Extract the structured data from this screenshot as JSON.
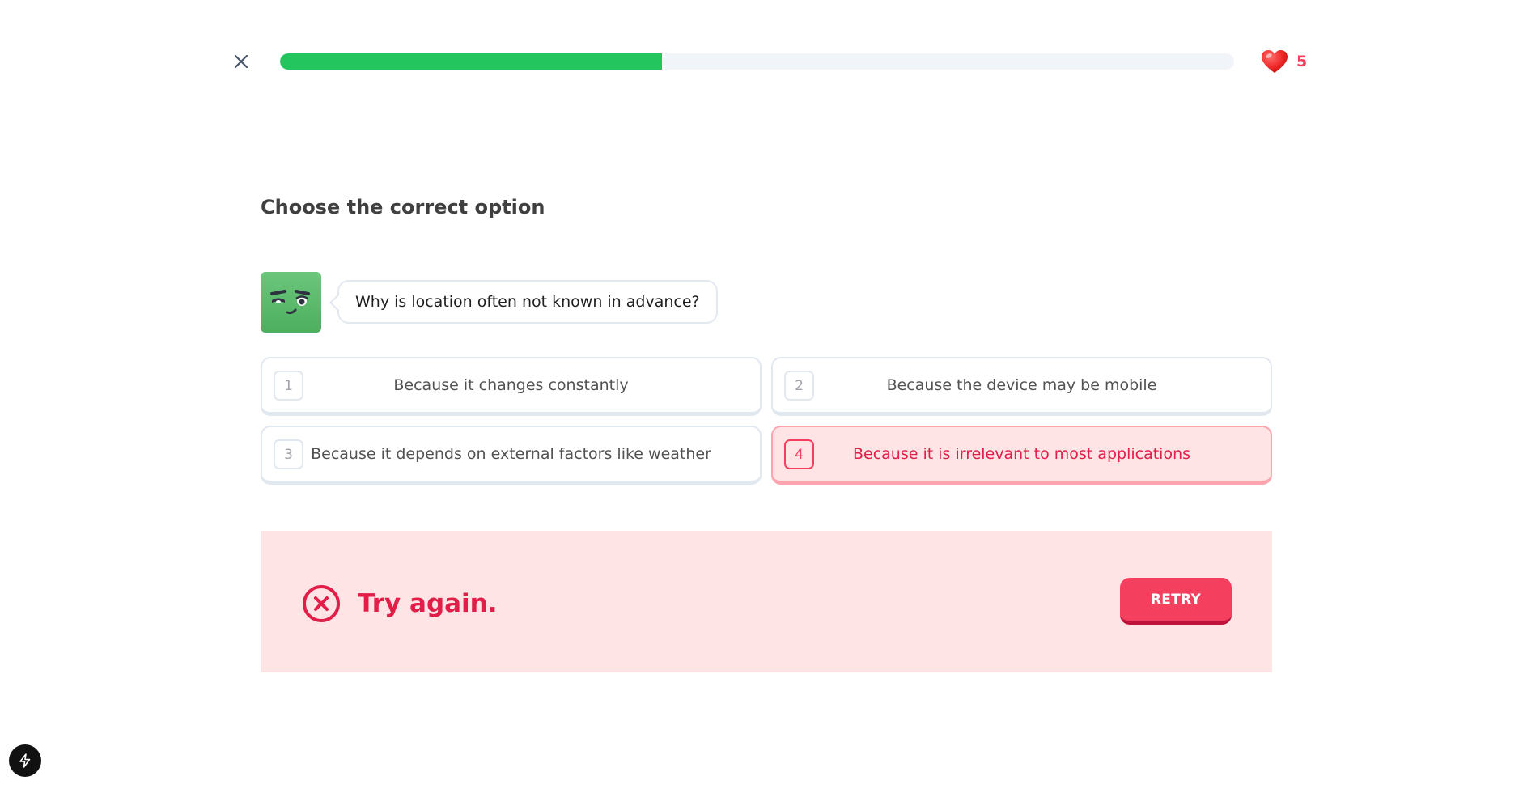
{
  "header": {
    "close_icon": "close-icon",
    "progress_fraction": 0.4,
    "progress_color": "#22c55e",
    "hearts_icon": "heart-icon",
    "hearts_count": "5"
  },
  "prompt": {
    "title": "Choose the correct option",
    "mascot_icon": "mascot-face",
    "question": "Why is location often not known in advance?"
  },
  "options": [
    {
      "number": "1",
      "label": "Because it changes constantly",
      "state": "default"
    },
    {
      "number": "2",
      "label": "Because the device may be mobile",
      "state": "default"
    },
    {
      "number": "3",
      "label": "Because it depends on external factors like weather",
      "state": "default"
    },
    {
      "number": "4",
      "label": "Because it is irrelevant to most applications",
      "state": "wrong"
    }
  ],
  "feedback": {
    "icon": "error-circle-icon",
    "message": "Try again.",
    "retry_label": "RETRY",
    "accent_color": "#f43f5e",
    "background_color": "#ffe4e6"
  },
  "devtools": {
    "icon": "lightning-icon"
  }
}
